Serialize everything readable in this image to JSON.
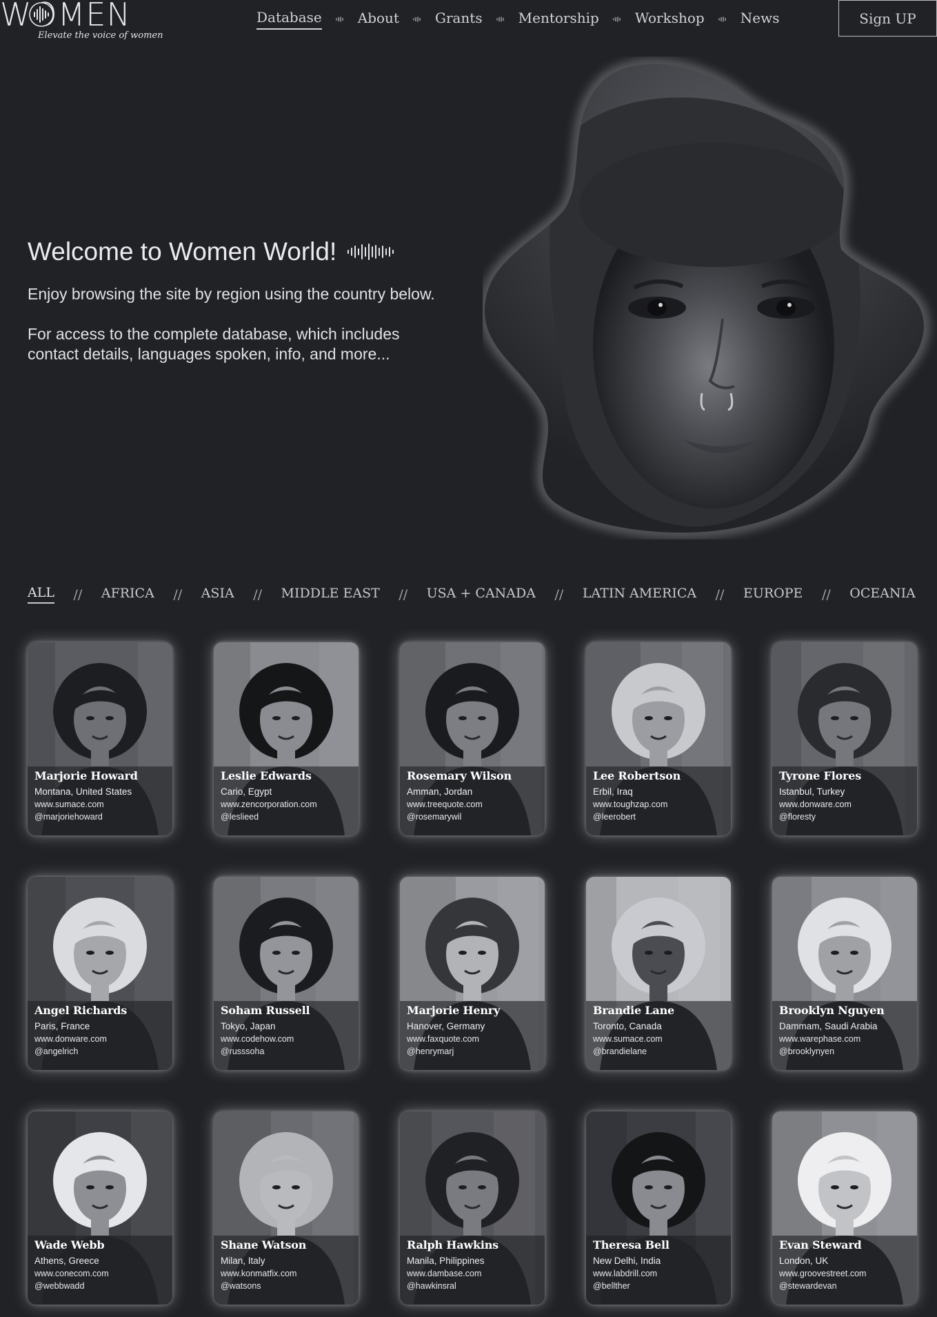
{
  "header": {
    "logo_text": "WOMEN",
    "tagline": "Elevate the voice of women",
    "nav": [
      {
        "label": "Database",
        "active": true
      },
      {
        "label": "About",
        "active": false
      },
      {
        "label": "Grants",
        "active": false
      },
      {
        "label": "Mentorship",
        "active": false
      },
      {
        "label": "Workshop",
        "active": false
      },
      {
        "label": "News",
        "active": false
      }
    ],
    "signup_label": "Sign UP"
  },
  "hero": {
    "title": "Welcome to Women World!",
    "paragraph1": "Enjoy browsing the site by region using the country below.",
    "paragraph2": "For access to the complete database, which includes contact details, languages spoken, info, and more...",
    "image_icon": "portrait-blob-image"
  },
  "regions": {
    "separator": "//",
    "items": [
      {
        "label": "ALL",
        "active": true
      },
      {
        "label": "AFRICA",
        "active": false
      },
      {
        "label": "ASIA",
        "active": false
      },
      {
        "label": "MIDDLE EAST",
        "active": false
      },
      {
        "label": "USA + CANADA",
        "active": false
      },
      {
        "label": "LATIN AMERICA",
        "active": false
      },
      {
        "label": "EUROPE",
        "active": false
      },
      {
        "label": "OCEANIA",
        "active": false
      }
    ]
  },
  "profiles": [
    {
      "name": "Marjorie Howard",
      "location": "Montana, United States",
      "website": "www.sumace.com",
      "handle": "@marjoriehoward"
    },
    {
      "name": "Leslie Edwards",
      "location": "Cario, Egypt",
      "website": "www.zencorporation.com",
      "handle": "@leslieed"
    },
    {
      "name": "Rosemary Wilson",
      "location": "Amman, Jordan",
      "website": "www.treequote.com",
      "handle": "@rosemarywil"
    },
    {
      "name": "Lee Robertson",
      "location": "Erbil, Iraq",
      "website": "www.toughzap.com",
      "handle": "@leerobert"
    },
    {
      "name": "Tyrone Flores",
      "location": "Istanbul, Turkey",
      "website": "www.donware.com",
      "handle": "@floresty"
    },
    {
      "name": "Angel Richards",
      "location": "Paris, France",
      "website": "www.donware.com",
      "handle": "@angelrich"
    },
    {
      "name": "Soham Russell",
      "location": "Tokyo, Japan",
      "website": "www.codehow.com",
      "handle": "@russsoha"
    },
    {
      "name": "Marjorie Henry",
      "location": "Hanover, Germany",
      "website": "www.faxquote.com",
      "handle": "@henrymarj"
    },
    {
      "name": "Brandie Lane",
      "location": "Toronto, Canada",
      "website": "www.sumace.com",
      "handle": "@brandielane"
    },
    {
      "name": "Brooklyn Nguyen",
      "location": "Dammam, Saudi Arabia",
      "website": "www.warephase.com",
      "handle": "@brooklynyen"
    },
    {
      "name": "Wade Webb",
      "location": "Athens, Greece",
      "website": "www.conecom.com",
      "handle": "@webbwadd"
    },
    {
      "name": "Shane Watson",
      "location": "Milan, Italy",
      "website": "www.konmatfix.com",
      "handle": "@watsons"
    },
    {
      "name": "Ralph Hawkins",
      "location": "Manila, Philippines",
      "website": "www.dambase.com",
      "handle": "@hawkinsral"
    },
    {
      "name": "Theresa Bell",
      "location": "New Delhi, India",
      "website": "www.labdrill.com",
      "handle": "@bellther"
    },
    {
      "name": "Evan Steward",
      "location": "London, UK",
      "website": "www.groovestreet.com",
      "handle": "@stewardevan"
    }
  ]
}
